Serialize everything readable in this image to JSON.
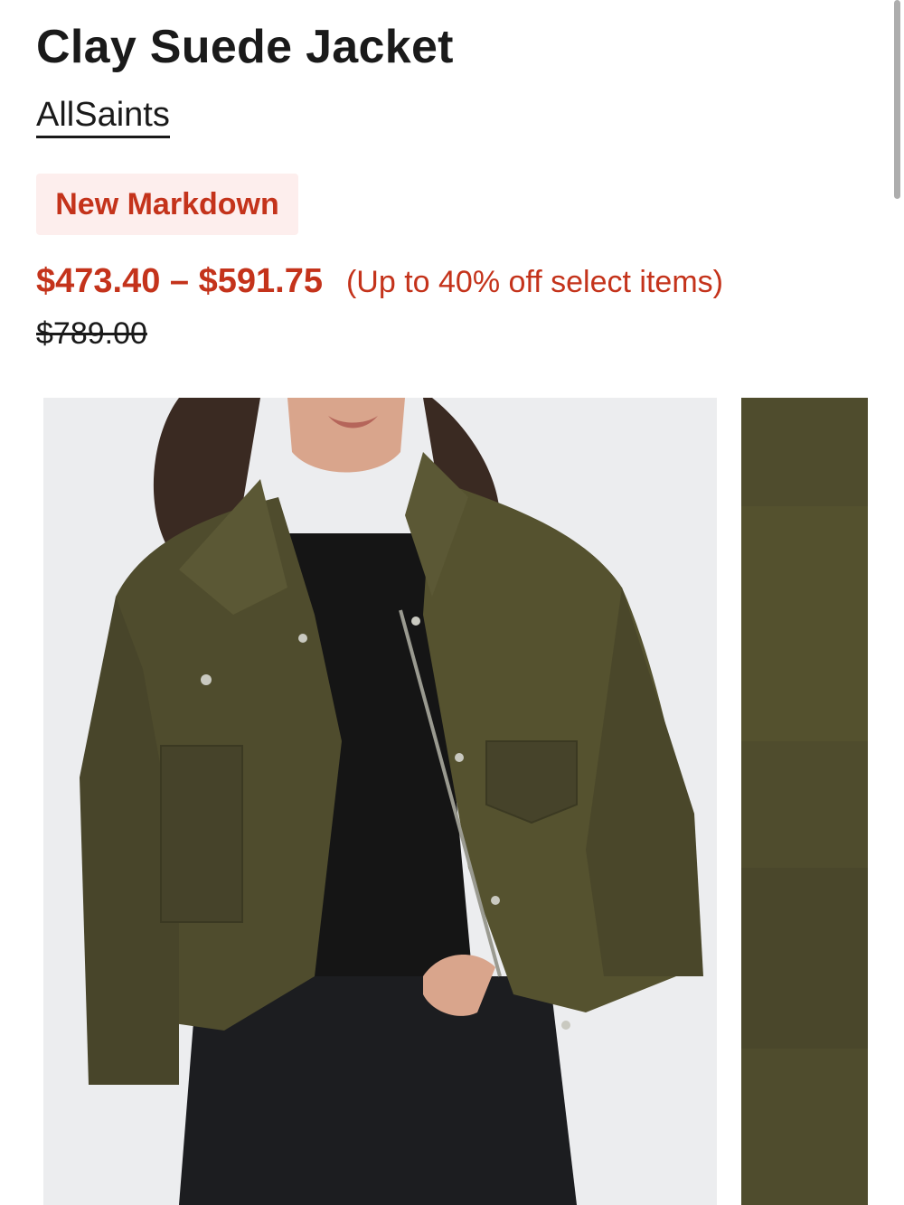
{
  "product": {
    "title": "Clay Suede Jacket",
    "brand": "AllSaints",
    "badge": "New Markdown",
    "price_range": "$473.40 – $591.75",
    "discount_note": "(Up to 40% off select items)",
    "original_price": "$789.00"
  },
  "colors": {
    "sale_red": "#c4331b",
    "badge_bg": "#fdeeed",
    "jacket_olive": "#4f4c2d"
  },
  "gallery": {
    "images": [
      {
        "name": "product-photo-main"
      },
      {
        "name": "product-photo-detail"
      }
    ]
  }
}
